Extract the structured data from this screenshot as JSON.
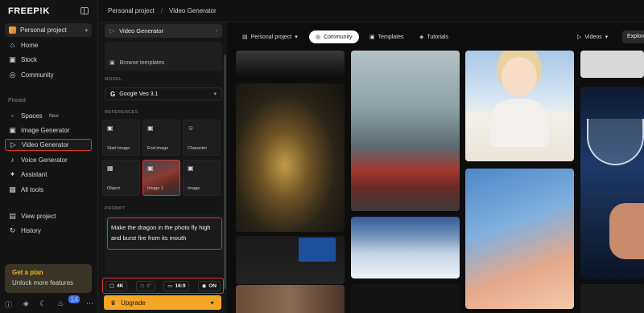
{
  "sidebar": {
    "logo": "FREEP!K",
    "project": "Personal project",
    "nav": [
      {
        "label": "Home",
        "icon": "home-icon"
      },
      {
        "label": "Stock",
        "icon": "stock-icon"
      },
      {
        "label": "Community",
        "icon": "globe-icon"
      }
    ],
    "pinned_label": "Pinned",
    "pinned": [
      {
        "label": "Spaces",
        "icon": "spaces-icon",
        "badge": "New"
      },
      {
        "label": "Image Generator",
        "icon": "image-icon"
      },
      {
        "label": "Video Generator",
        "icon": "video-icon",
        "active": true
      },
      {
        "label": "Voice Generator",
        "icon": "voice-icon"
      },
      {
        "label": "Assistant",
        "icon": "assistant-icon"
      },
      {
        "label": "All tools",
        "icon": "grid-icon"
      }
    ],
    "bottom_nav": [
      {
        "label": "View project",
        "icon": "folder-icon"
      },
      {
        "label": "History",
        "icon": "history-icon"
      }
    ],
    "plan": {
      "title": "Get a plan",
      "subtitle": "Unlock more features"
    },
    "notification_count": "14"
  },
  "topbar": {
    "breadcrumb": [
      "Personal project",
      "Video Generator"
    ]
  },
  "panel": {
    "tool": "Video Generator",
    "browse_templates": "Browse templates",
    "model_label": "MODEL",
    "model": "Google Veo 3.1",
    "references_label": "REFERENCES",
    "references": [
      "Start image",
      "End image",
      "Character",
      "Object",
      "Image 1",
      "Image"
    ],
    "prompt_label": "PROMPT",
    "prompt": "Make the dragon in the photo fly high and burst fire from its mouth",
    "settings": {
      "resolution": "4K",
      "duration": "8\"",
      "aspect": "16:9",
      "audio": "ON"
    },
    "upgrade": "Upgrade"
  },
  "main": {
    "filters": {
      "project": "Personal project",
      "community": "Community",
      "templates": "Templates",
      "tutorials": "Tutorials",
      "media": "Videos",
      "explore": "Explore"
    }
  }
}
